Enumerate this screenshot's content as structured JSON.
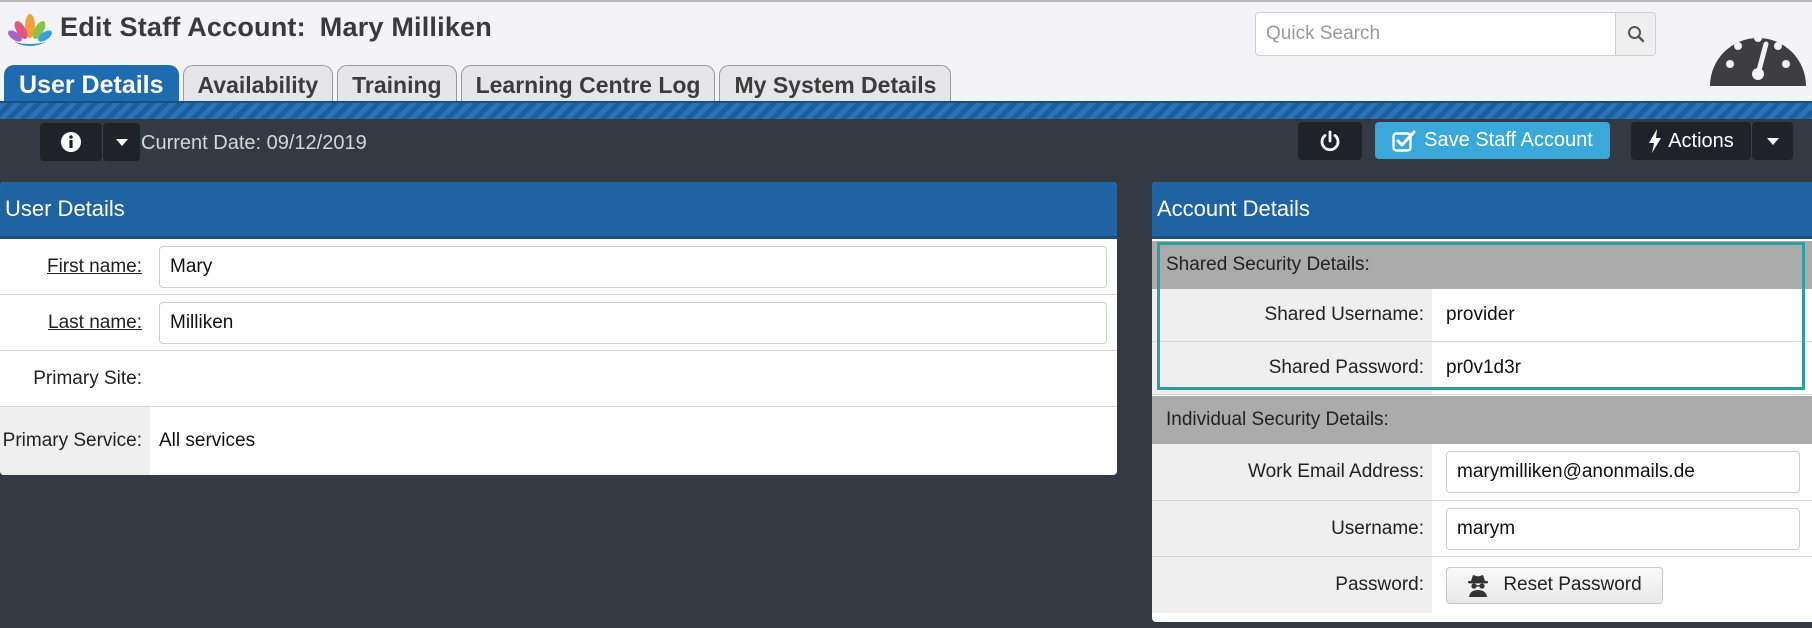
{
  "header": {
    "title_prefix": "Edit Staff Account:",
    "title_name": "Mary Milliken",
    "search": {
      "placeholder": "Quick Search",
      "value": ""
    }
  },
  "tabs": [
    {
      "label": "User Details",
      "active": true
    },
    {
      "label": "Availability",
      "active": false
    },
    {
      "label": "Training",
      "active": false
    },
    {
      "label": "Learning Centre Log",
      "active": false
    },
    {
      "label": "My System Details",
      "active": false
    }
  ],
  "toolbar": {
    "current_date_label": "Current Date: 09/12/2019",
    "save_label": "Save Staff Account",
    "actions_label": "Actions"
  },
  "user_details": {
    "title": "User Details",
    "first_name": {
      "label": "First name:",
      "value": "Mary"
    },
    "last_name": {
      "label": "Last name:",
      "value": "Milliken"
    },
    "primary_site": {
      "label": "Primary Site:",
      "value": ""
    },
    "primary_service": {
      "label": "Primary Service:",
      "value": "All services"
    }
  },
  "account_details": {
    "title": "Account Details",
    "shared_section": "Shared Security Details:",
    "shared_username": {
      "label": "Shared Username:",
      "value": "provider"
    },
    "shared_password": {
      "label": "Shared Password:",
      "value": "pr0v1d3r"
    },
    "individual_section": "Individual Security Details:",
    "work_email": {
      "label": "Work Email Address:",
      "value": "marymilliken@anonmails.de"
    },
    "username": {
      "label": "Username:",
      "value": "marym"
    },
    "password": {
      "label": "Password:",
      "button": "Reset Password"
    }
  },
  "colors": {
    "brand_blue": "#2063a3",
    "toolbar_dark": "#343a44",
    "save_button": "#3aa8d8",
    "highlight_teal": "#2aa0a4"
  },
  "icons": [
    "lotus-logo-icon",
    "search-icon",
    "speedometer-icon",
    "info-icon",
    "caret-down-icon",
    "power-icon",
    "checkbox-icon",
    "lightning-icon",
    "spy-icon"
  ]
}
